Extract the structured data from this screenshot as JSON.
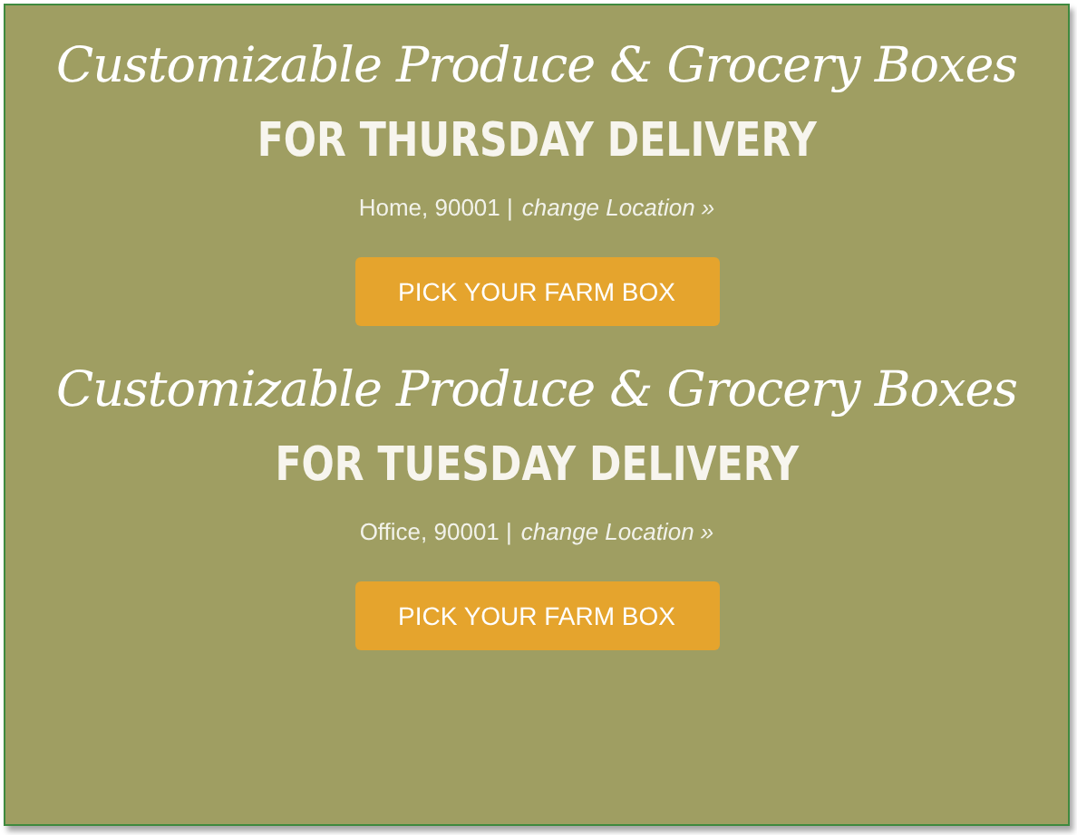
{
  "sections": [
    {
      "title": "Customizable Produce & Grocery Boxes",
      "heading": "FOR THURSDAY DELIVERY",
      "location": "Home, 90001 |",
      "link": "change Location »",
      "button": "PICK YOUR FARM BOX"
    },
    {
      "title": "Customizable Produce & Grocery Boxes",
      "heading": "FOR TUESDAY DELIVERY",
      "location": "Office, 90001 |",
      "link": "change Location »",
      "button": "PICK YOUR FARM BOX"
    }
  ]
}
